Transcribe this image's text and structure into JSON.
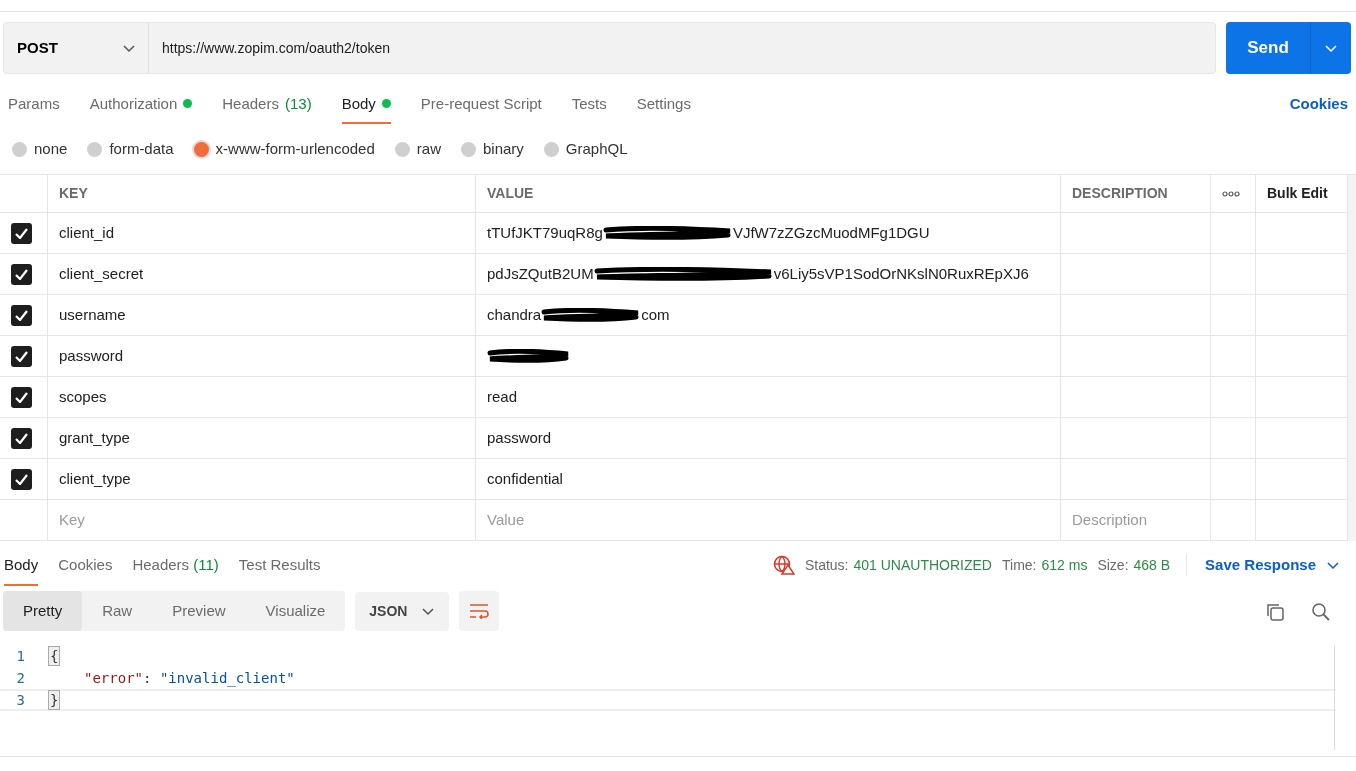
{
  "request": {
    "method": "POST",
    "url": "https://www.zopim.com/oauth2/token",
    "send_label": "Send"
  },
  "request_tabs": [
    {
      "label": "Params",
      "selected": false
    },
    {
      "label": "Authorization",
      "dot": true,
      "selected": false
    },
    {
      "label": "Headers",
      "count": "(13)",
      "selected": false
    },
    {
      "label": "Body",
      "dot": true,
      "selected": true
    },
    {
      "label": "Pre-request Script",
      "selected": false
    },
    {
      "label": "Tests",
      "selected": false
    },
    {
      "label": "Settings",
      "selected": false
    }
  ],
  "cookies_link": "Cookies",
  "body_types": [
    {
      "label": "none",
      "selected": false
    },
    {
      "label": "form-data",
      "selected": false
    },
    {
      "label": "x-www-form-urlencoded",
      "selected": true
    },
    {
      "label": "raw",
      "selected": false
    },
    {
      "label": "binary",
      "selected": false
    },
    {
      "label": "GraphQL",
      "selected": false
    }
  ],
  "table": {
    "columns": [
      "KEY",
      "VALUE",
      "DESCRIPTION"
    ],
    "bulk_edit": "Bulk Edit",
    "rows": [
      {
        "checked": true,
        "key": "client_id",
        "value": "tTUfJKT79uqR8g",
        "redacted": true,
        "value_end": "VJfW7zZGzcMuodMFg1DGU"
      },
      {
        "checked": true,
        "key": "client_secret",
        "value": "pdJsZQutB2UM",
        "redacted": true,
        "value_end": "v6Liy5sVP1SodOrNKslN0RuxREpXJ6"
      },
      {
        "checked": true,
        "key": "username",
        "value": "chandra",
        "redacted": true,
        "value_end": "com"
      },
      {
        "checked": true,
        "key": "password",
        "redacted": true
      },
      {
        "checked": true,
        "key": "scopes",
        "value": "read",
        "redacted": false
      },
      {
        "checked": true,
        "key": "grant_type",
        "value": "password",
        "redacted": false
      },
      {
        "checked": true,
        "key": "client_type",
        "value": "confidential",
        "redacted": false
      }
    ],
    "placeholders": {
      "key": "Key",
      "value": "Value",
      "description": "Description"
    }
  },
  "response_tabs": [
    {
      "label": "Body",
      "selected": true
    },
    {
      "label": "Cookies",
      "selected": false
    },
    {
      "label": "Headers",
      "count": "(11)",
      "selected": false
    },
    {
      "label": "Test Results",
      "selected": false
    }
  ],
  "status": {
    "status_label": "Status:",
    "status_value": "401 UNAUTHORIZED",
    "time_label": "Time:",
    "time_value": "612 ms",
    "size_label": "Size:",
    "size_value": "468 B",
    "save_label": "Save Response"
  },
  "view_modes": [
    {
      "label": "Pretty",
      "selected": true
    },
    {
      "label": "Raw",
      "selected": false
    },
    {
      "label": "Preview",
      "selected": false
    },
    {
      "label": "Visualize",
      "selected": false
    }
  ],
  "format": "JSON",
  "code_lines": [
    {
      "number": "1",
      "text": "{",
      "kind": "brace"
    },
    {
      "number": "2",
      "key": "\"error\"",
      "text": ": ",
      "value": "\"invalid_client\"",
      "kind": "pair"
    },
    {
      "number": "3",
      "text": "}",
      "kind": "brace"
    }
  ]
}
